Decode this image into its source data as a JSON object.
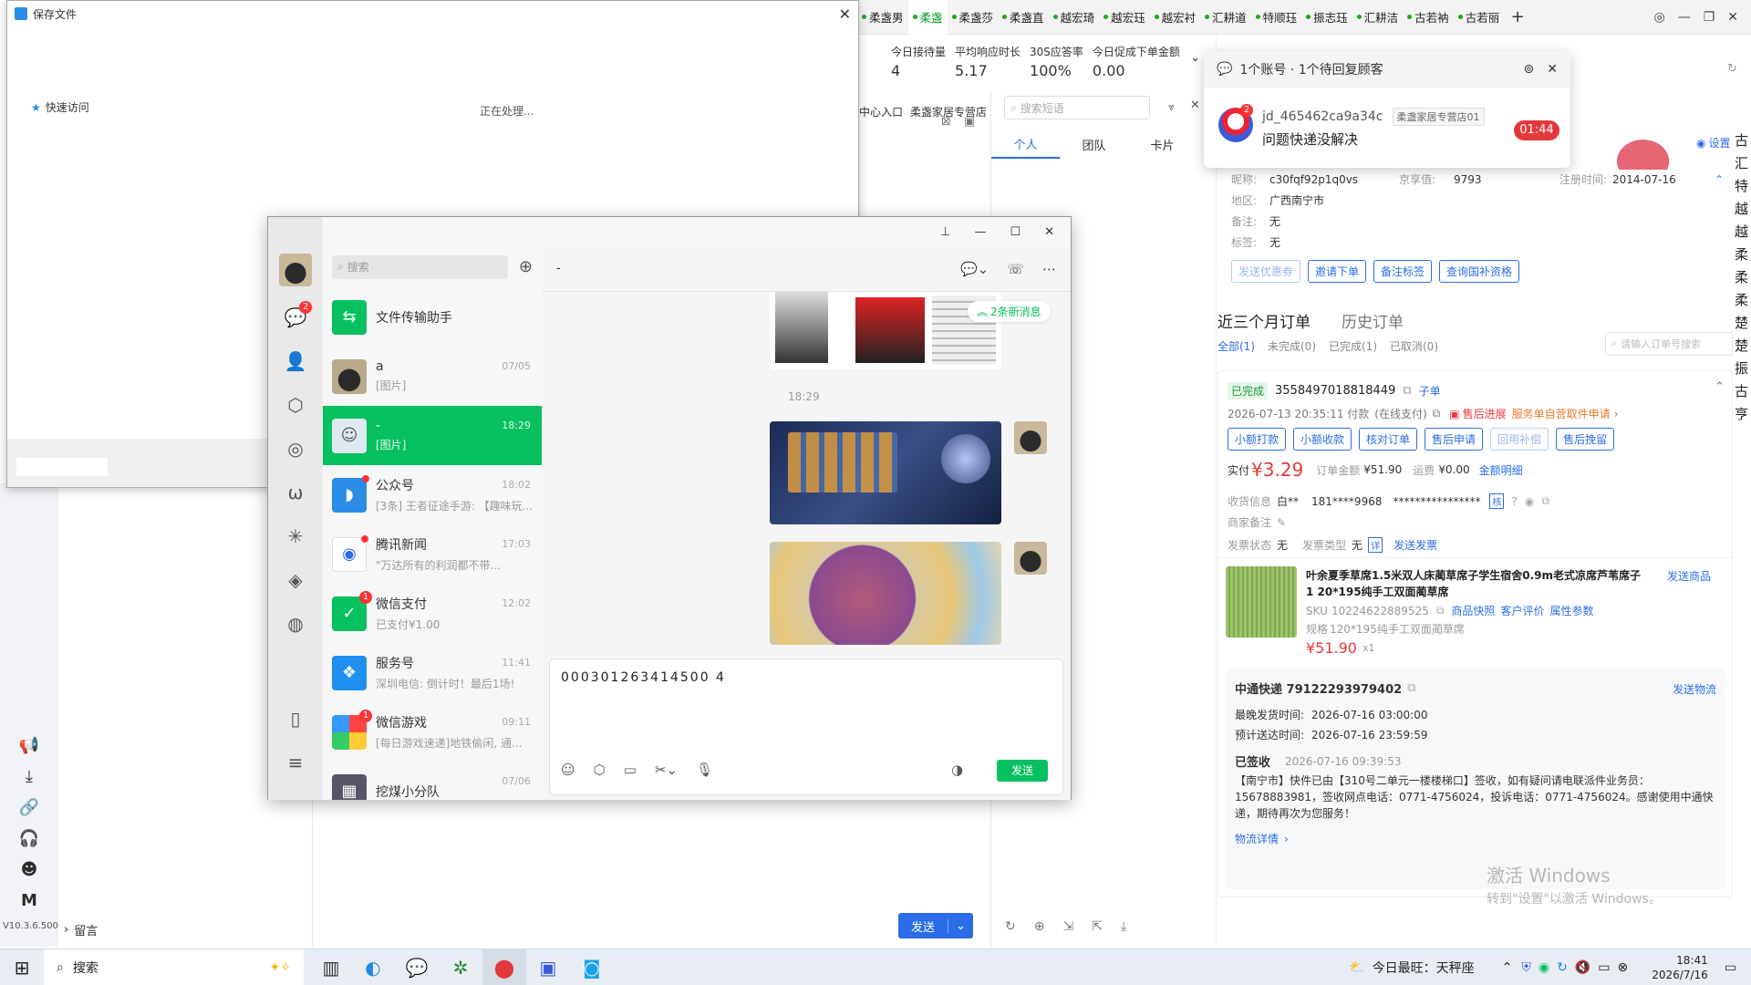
{
  "top_tabs": [
    "柔盏男",
    "柔盏",
    "柔盏莎",
    "柔盏直",
    "越宏琦",
    "越宏珏",
    "越宏衬",
    "汇耕道",
    "特顺珏",
    "振志珏",
    "汇耕洁",
    "古若衲",
    "古若丽"
  ],
  "stats": {
    "labels": [
      "今日接待量",
      "平均响应时长",
      "30S应答率",
      "今日促成下单金额"
    ],
    "values": [
      "4",
      "5.17",
      "100%",
      "0.00"
    ]
  },
  "under_stats": {
    "entry": "中心入口",
    "shop": "柔盏家居专营店"
  },
  "phrases": {
    "search_placeholder": "搜索短语",
    "tabs": [
      "个人",
      "团队",
      "卡片"
    ]
  },
  "notice": {
    "header": "1个账号 · 1个待回复顾客",
    "user": "jd_465462ca9a34c",
    "shop": "柔盏家居专营店01",
    "message": "问题快递没解决",
    "timer": "01:44",
    "badge": "2"
  },
  "settings_label": "设置",
  "customer": {
    "nick_label": "昵称:",
    "nick": "c30fqf92p1q0vs",
    "jx_label": "京享值:",
    "jx": "9793",
    "reg_label": "注册时间:",
    "reg": "2014-07-16",
    "area_label": "地区:",
    "area": "广西南宁市",
    "note_label": "备注:",
    "note": "无",
    "tag_label": "标签:",
    "tag": "无",
    "buttons": [
      "发送优惠券",
      "邀请下单",
      "备注标签",
      "查询国补资格"
    ]
  },
  "orders": {
    "tab_recent": "近三个月订单",
    "tab_history": "历史订单",
    "filters": [
      "全部(1)",
      "未完成(0)",
      "已完成(1)",
      "已取消(0)"
    ],
    "search_placeholder": "请输入订单号搜索",
    "status": "已完成",
    "order_no": "3558497018818449",
    "sub": "子单",
    "time": "2026-07-13 20:35:11 付款",
    "pay": "(在线支付)",
    "after_sale": "售后进展",
    "after_detail": "服务单自营取件申请",
    "buttons": [
      "小额打款",
      "小额收款",
      "核对订单",
      "售后申请",
      "回用补偿",
      "售后挽留"
    ],
    "paid_label": "实付",
    "paid": "¥3.29",
    "amount_label": "订单金额",
    "amount": "¥51.90",
    "freight_label": "运费",
    "freight": "¥0.00",
    "detail_link": "金额明细",
    "recv_label": "收货信息",
    "recv_name": "白**",
    "recv_phone": "181****9968",
    "recv_addr": "****************",
    "recv_tag": "核",
    "merchant_label": "商家备注",
    "inv_status_label": "发票状态",
    "inv_status": "无",
    "inv_type_label": "发票类型",
    "inv_type": "无",
    "inv_tag": "详",
    "send_invoice": "发送发票",
    "product_title": "叶余夏季草席1.5米双人床蔺草席子学生宿舍0.9m老式凉席芦苇席子 1 20*195纯手工双面蔺草席",
    "send_product": "发送商品",
    "sku_label": "SKU",
    "sku": "10224622889525",
    "sku_links": [
      "商品快照",
      "客户评价",
      "属性参数"
    ],
    "spec_label": "规格",
    "spec": "120*195纯手工双面蔺草席",
    "price": "¥51.90",
    "qty": "x1",
    "express": "中通快递 79122293979402",
    "send_logistics": "发送物流",
    "latest_ship_label": "最晚发货时间:",
    "latest_ship": "2026-07-16 03:00:00",
    "eta_label": "预计送达时间:",
    "eta": "2026-07-16 23:59:59",
    "signed": "已签收",
    "signed_time": "2026-07-16 09:39:53",
    "logistics_text": "【南宁市】快件已由【310号二单元一楼楼梯口】签收，如有疑问请电联派件业务员：15678883981，签收网点电话：0771-4756024，投诉电话：0771-4756024。感谢使用中通快递，期待再次为您服务！",
    "logistics_link": "物流详情"
  },
  "activate": {
    "line1": "激活 Windows",
    "line2": "转到\"设置\"以激活 Windows。"
  },
  "save_dialog": {
    "title": "保存文件",
    "quick_access": "快速访问",
    "processing": "正在处理..."
  },
  "shop_left": {
    "version": "V10.3.6.500",
    "leave_msg": "留言",
    "send": "发送"
  },
  "right_vertical": [
    "古",
    "汇",
    "特",
    "越",
    "越",
    "柔",
    "柔",
    "柔",
    "楚",
    "楚",
    "振",
    "古",
    "亨"
  ],
  "wechat": {
    "search_placeholder": "搜索",
    "nav_badge": "2",
    "chat_title": "-",
    "new_msg": "2条新消息",
    "time_label": "18:29",
    "input_text": "000301263414500 4",
    "send": "发送",
    "chats": [
      {
        "name": "文件传输助手",
        "preview": "",
        "time": ""
      },
      {
        "name": "a",
        "preview": "[图片]",
        "time": "07/05"
      },
      {
        "name": "-",
        "preview": "[图片]",
        "time": "18:29"
      },
      {
        "name": "公众号",
        "preview": "[3条] 王者征途手游: 【趣味玩...",
        "time": "18:02"
      },
      {
        "name": "腾讯新闻",
        "preview": "\"万达所有的利润都不带...",
        "time": "17:03"
      },
      {
        "name": "微信支付",
        "preview": "已支付¥1.00",
        "time": "12:02"
      },
      {
        "name": "服务号",
        "preview": "深圳电信: 倒计时！最后1场!",
        "time": "11:41"
      },
      {
        "name": "微信游戏",
        "preview": "[每日游戏速递]地铁偷闲, 通...",
        "time": "09:11"
      },
      {
        "name": "挖煤小分队",
        "preview": "",
        "time": "07/06"
      }
    ],
    "badges": {
      "pay": "1",
      "game": "1"
    }
  },
  "taskbar": {
    "search": "搜索",
    "weather": "今日最旺：天秤座",
    "time": "18:41",
    "date": "2026/7/16"
  },
  "colors": {
    "accent": "#2b6de8",
    "wechat_green": "#07c160",
    "price_red": "#e4393c",
    "taskbar": "#e8edf3"
  }
}
